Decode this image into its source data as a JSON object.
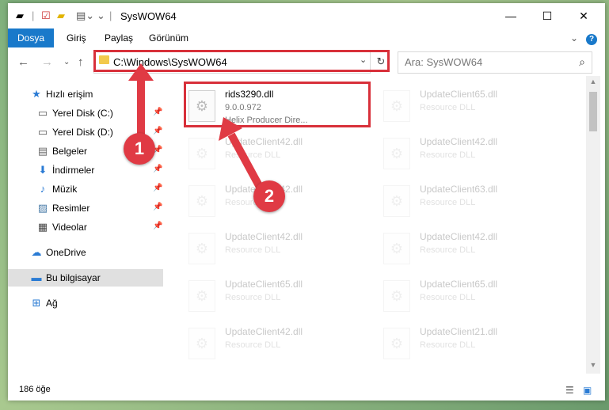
{
  "window": {
    "title": "SysWOW64",
    "minimize_glyph": "—",
    "maximize_glyph": "☐",
    "close_glyph": "✕"
  },
  "ribbon": {
    "tabs": [
      "Dosya",
      "Giriş",
      "Paylaş",
      "Görünüm"
    ],
    "collapse_glyph": "⌄",
    "help_glyph": "?"
  },
  "address": {
    "path": "C:\\Windows\\SysWOW64",
    "dropdown_glyph": "⌄",
    "refresh_glyph": "↻"
  },
  "search": {
    "placeholder": "Ara: SysWOW64",
    "icon": "search-icon"
  },
  "sidebar": {
    "items": [
      {
        "label": "Hızlı erişim",
        "icon": "star-icon",
        "glyph": "★",
        "pinned": false
      },
      {
        "label": "Yerel Disk (C:)",
        "icon": "drive-icon",
        "glyph": "▭",
        "pinned": true
      },
      {
        "label": "Yerel Disk (D:)",
        "icon": "drive-icon",
        "glyph": "▭",
        "pinned": true
      },
      {
        "label": "Belgeler",
        "icon": "document-icon",
        "glyph": "▤",
        "pinned": true
      },
      {
        "label": "İndirmeler",
        "icon": "download-icon",
        "glyph": "⬇",
        "pinned": true
      },
      {
        "label": "Müzik",
        "icon": "music-icon",
        "glyph": "♪",
        "pinned": true
      },
      {
        "label": "Resimler",
        "icon": "picture-icon",
        "glyph": "▨",
        "pinned": true
      },
      {
        "label": "Videolar",
        "icon": "video-icon",
        "glyph": "▦",
        "pinned": true
      },
      {
        "label": "OneDrive",
        "icon": "cloud-icon",
        "glyph": "☁",
        "pinned": false
      },
      {
        "label": "Bu bilgisayar",
        "icon": "computer-icon",
        "glyph": "▬",
        "pinned": false
      },
      {
        "label": "Ağ",
        "icon": "network-icon",
        "glyph": "⊞",
        "pinned": false
      }
    ]
  },
  "files": [
    {
      "name": "rids3290.dll",
      "line2": "9.0.0.972",
      "line3": "Helix Producer Dire...",
      "highlight": true
    },
    {
      "name": "UpdateClient65.dll",
      "line2": "Resource DLL",
      "line3": "",
      "highlight": false
    },
    {
      "name": "UpdateClient42.dll",
      "line2": "Resource DLL",
      "line3": "",
      "highlight": false
    },
    {
      "name": "UpdateClient42.dll",
      "line2": "Resource DLL",
      "line3": "",
      "highlight": false
    },
    {
      "name": "UpdateClient42.dll",
      "line2": "Resource DLL",
      "line3": "",
      "highlight": false
    },
    {
      "name": "UpdateClient63.dll",
      "line2": "Resource DLL",
      "line3": "",
      "highlight": false
    },
    {
      "name": "UpdateClient42.dll",
      "line2": "Resource DLL",
      "line3": "",
      "highlight": false
    },
    {
      "name": "UpdateClient42.dll",
      "line2": "Resource DLL",
      "line3": "",
      "highlight": false
    },
    {
      "name": "UpdateClient65.dll",
      "line2": "Resource DLL",
      "line3": "",
      "highlight": false
    },
    {
      "name": "UpdateClient65.dll",
      "line2": "Resource DLL",
      "line3": "",
      "highlight": false
    },
    {
      "name": "UpdateClient42.dll",
      "line2": "Resource DLL",
      "line3": "",
      "highlight": false
    },
    {
      "name": "UpdateClient21.dll",
      "line2": "Resource DLL",
      "line3": "",
      "highlight": false
    }
  ],
  "status": {
    "count": "186 öğe"
  },
  "annotations": {
    "step1": "1",
    "step2": "2",
    "highlight_color": "#d8303a"
  },
  "colors": {
    "accent": "#1979ca",
    "selection": "#e0e0e0"
  }
}
